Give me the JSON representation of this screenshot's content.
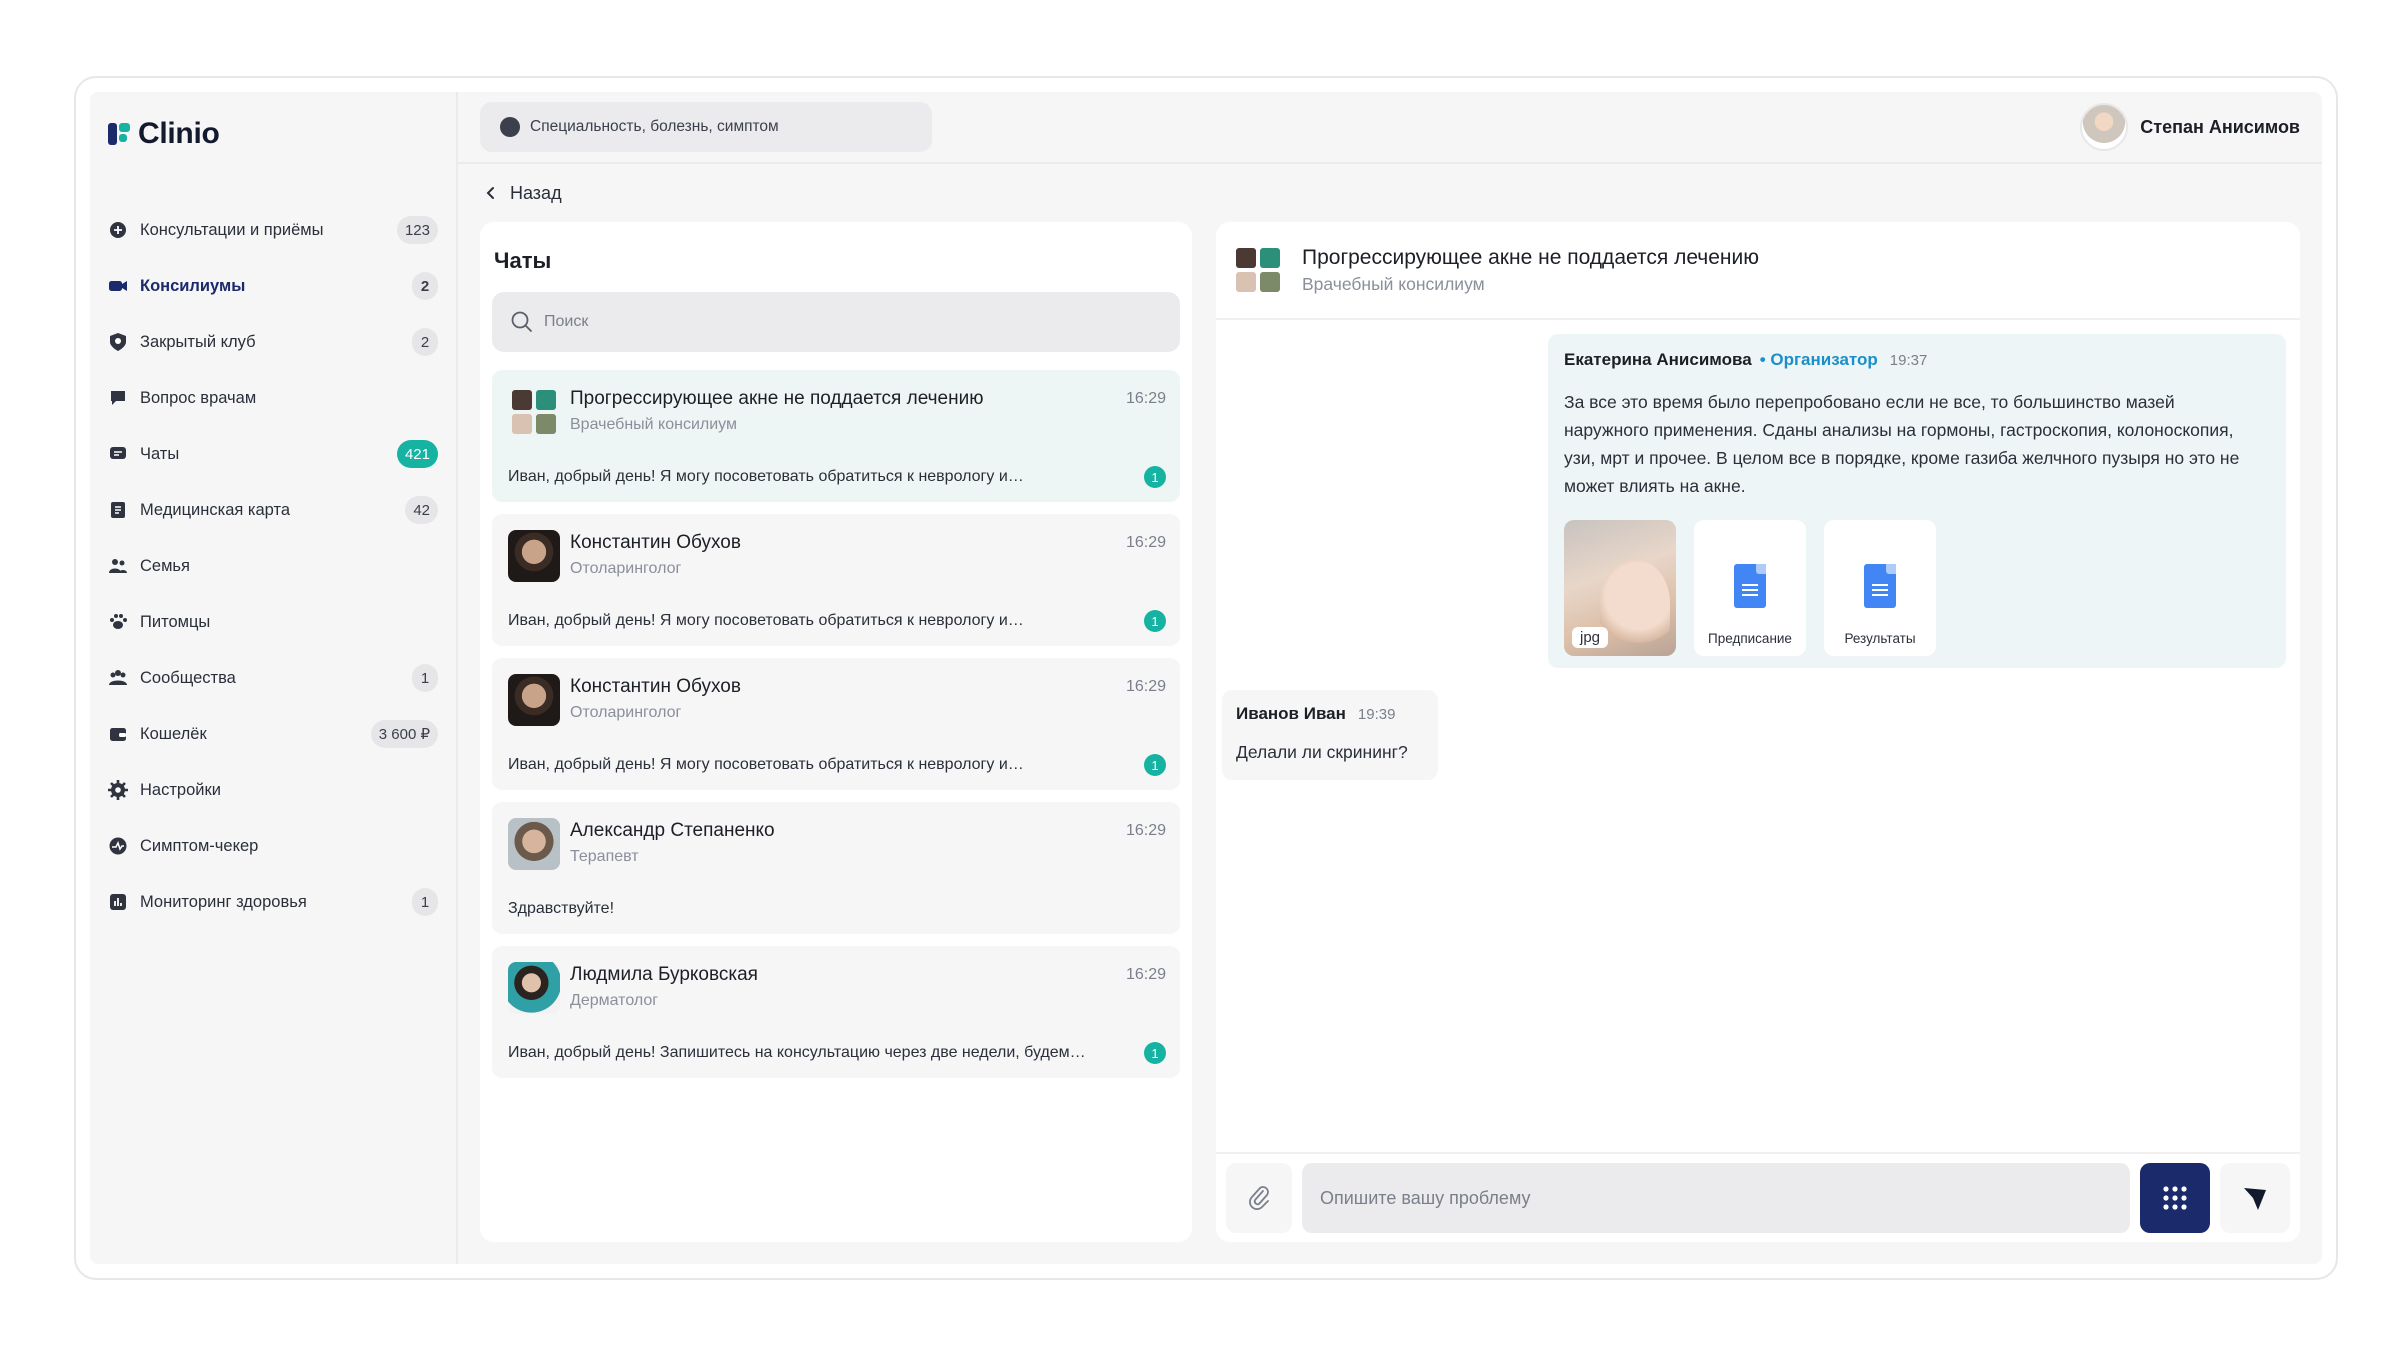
{
  "brand": {
    "name": "Clinio"
  },
  "search": {
    "placeholder": "Специальность, болезнь, симптом"
  },
  "user": {
    "name": "Степан Анисимов"
  },
  "sidebar": {
    "items": [
      {
        "label": "Консультации и приёмы",
        "badge": "123",
        "icon": "plus-circle-icon"
      },
      {
        "label": "Консилиумы",
        "badge": "2",
        "icon": "video-camera-icon",
        "active": true
      },
      {
        "label": "Закрытый клуб",
        "badge": "2",
        "icon": "shield-icon"
      },
      {
        "label": "Вопрос врачам",
        "badge": "",
        "icon": "question-bubble-icon"
      },
      {
        "label": "Чаты",
        "badge": "421",
        "icon": "chat-icon",
        "teal": true
      },
      {
        "label": "Медицинская карта",
        "badge": "42",
        "icon": "medical-card-icon"
      },
      {
        "label": "Семья",
        "badge": "",
        "icon": "family-icon"
      },
      {
        "label": "Питомцы",
        "badge": "",
        "icon": "paw-icon"
      },
      {
        "label": "Сообщества",
        "badge": "1",
        "icon": "community-icon"
      },
      {
        "label": "Кошелёк",
        "badge": "3 600 ₽",
        "icon": "wallet-icon"
      },
      {
        "label": "Настройки",
        "badge": "",
        "icon": "gear-icon"
      },
      {
        "label": "Симптом-чекер",
        "badge": "",
        "icon": "pulse-icon"
      },
      {
        "label": "Мониторинг здоровья",
        "badge": "1",
        "icon": "chart-icon"
      }
    ]
  },
  "nav": {
    "back_label": "Назад"
  },
  "chats": {
    "title": "Чаты",
    "search_placeholder": "Поиск",
    "list": [
      {
        "name": "Прогрессирующее акне не поддается лечению",
        "sub": "Врачебный консилиум",
        "time": "16:29",
        "message": "Иван, добрый день! Я могу посоветовать обратиться к неврологу и…",
        "unread": "1",
        "group": true,
        "active": true
      },
      {
        "name": "Константин Обухов",
        "sub": "Отоларинголог",
        "time": "16:29",
        "message": "Иван, добрый день! Я могу посоветовать обратиться к неврологу и…",
        "unread": "1"
      },
      {
        "name": "Константин Обухов",
        "sub": "Отоларинголог",
        "time": "16:29",
        "message": "Иван, добрый день! Я могу посоветовать обратиться к неврологу и…",
        "unread": "1"
      },
      {
        "name": "Александр Степаненко",
        "sub": "Терапевт",
        "time": "16:29",
        "message": "Здравствуйте!",
        "unread": ""
      },
      {
        "name": "Людмила Бурковская",
        "sub": "Дерматолог",
        "time": "16:29",
        "message": "Иван, добрый день! Запишитесь на консультацию через две недели, будем…",
        "unread": "1"
      }
    ]
  },
  "conversation": {
    "title": "Прогрессирующее акне не поддается лечению",
    "subtitle": "Врачебный консилиум",
    "messages": [
      {
        "author": "Екатерина Анисимова",
        "role": "• Организатор",
        "time": "19:37",
        "text": "За все это время было перепробовано если не все, то большинство мазей наружного применения. Сданы анализы на гормоны, гастроскопия, колоноскопия, узи, мрт и прочее. В целом все в порядке, кроме газиба желчного пузыря но это не может влиять на акне.",
        "attachments": [
          {
            "type": "photo",
            "tag": "jpg"
          },
          {
            "type": "doc",
            "name": "Предписание"
          },
          {
            "type": "doc",
            "name": "Результаты"
          }
        ]
      },
      {
        "author": "Иванов Иван",
        "time": "19:39",
        "text": "Делали ли скрининг?"
      }
    ]
  },
  "composer": {
    "placeholder": "Опишите вашу проблему"
  },
  "colors": {
    "brand": "#1b2a6b",
    "accent": "#16b3a3",
    "organizer": "#1b8fc9"
  }
}
